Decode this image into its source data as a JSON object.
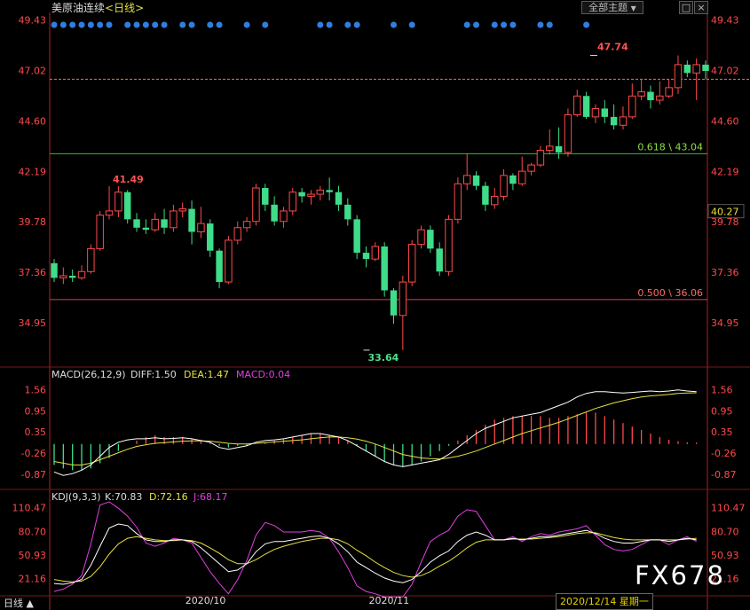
{
  "header": {
    "instrument": "美原油连续",
    "period": "<日线>",
    "dropdown_label": "全部主题",
    "dropdown_arrow": "▼"
  },
  "window_controls": {
    "square": "□",
    "close": "×"
  },
  "watermark": "FX678",
  "date_badge": "2020/12/14 星期一",
  "bottom_left": "日线 ▲",
  "colors": {
    "up": "#ff4a4a",
    "down": "#3fdc8a",
    "axis": "#b02020",
    "diff_line": "#ffffff",
    "dea_line": "#e8e040",
    "j_line": "#e040e0",
    "fib_618": "#30c030",
    "fib_500": "#d04060"
  },
  "chart_data": {
    "type": "candlestick",
    "price_axis": {
      "ticks": [
        49.43,
        47.02,
        44.6,
        42.19,
        39.78,
        37.36,
        34.95
      ],
      "tick_labels": [
        "49.43",
        "47.02",
        "44.60",
        "42.19",
        "39.78",
        "37.36",
        "34.95"
      ],
      "ylim": [
        33.0,
        49.8
      ]
    },
    "x_labels": [
      {
        "label": "2020/10",
        "index": 16.5
      },
      {
        "label": "2020/11",
        "index": 36.5
      }
    ],
    "annotations": {
      "high": {
        "label": "47.74",
        "value": 47.74,
        "index": 59
      },
      "prior_high": {
        "label": "41.49",
        "value": 41.49,
        "index": 6
      },
      "low": {
        "label": "33.64",
        "value": 33.64,
        "index": 34
      },
      "last_price": {
        "label": "40.27",
        "value": 40.27
      },
      "dashed_level": 46.6
    },
    "fib_levels": [
      {
        "label": "0.618 \\ 43.04",
        "value": 43.04
      },
      {
        "label": "0.500 \\ 36.06",
        "value": 36.06
      }
    ],
    "event_dots": [
      0,
      1,
      2,
      3,
      4,
      5,
      6,
      8,
      9,
      10,
      11,
      12,
      14,
      15,
      17,
      18,
      21,
      23,
      29,
      30,
      32,
      33,
      37,
      39,
      45,
      46,
      48,
      49,
      50,
      53,
      54,
      58
    ],
    "candles": [
      [
        37.8,
        37.1,
        38.0,
        36.9
      ],
      [
        37.1,
        37.2,
        37.6,
        36.8
      ],
      [
        37.2,
        37.1,
        37.5,
        36.9
      ],
      [
        37.1,
        37.4,
        37.7,
        37.0
      ],
      [
        37.4,
        38.5,
        38.7,
        37.3
      ],
      [
        38.5,
        40.1,
        40.3,
        38.4
      ],
      [
        40.1,
        40.3,
        41.49,
        39.9
      ],
      [
        40.3,
        41.2,
        41.49,
        40.0
      ],
      [
        41.2,
        39.9,
        41.3,
        39.7
      ],
      [
        39.9,
        39.5,
        40.2,
        39.3
      ],
      [
        39.5,
        39.4,
        39.9,
        39.2
      ],
      [
        39.4,
        39.9,
        40.2,
        39.3
      ],
      [
        39.9,
        39.5,
        40.4,
        39.2
      ],
      [
        39.5,
        40.3,
        40.6,
        39.3
      ],
      [
        40.3,
        40.4,
        40.7,
        40.0
      ],
      [
        40.4,
        39.3,
        40.8,
        38.7
      ],
      [
        39.3,
        39.7,
        40.5,
        39.0
      ],
      [
        39.7,
        38.4,
        39.9,
        38.1
      ],
      [
        38.4,
        36.9,
        38.5,
        36.6
      ],
      [
        36.9,
        38.9,
        39.1,
        36.8
      ],
      [
        38.9,
        39.5,
        39.8,
        38.7
      ],
      [
        39.5,
        39.8,
        40.0,
        39.3
      ],
      [
        39.8,
        41.4,
        41.6,
        39.6
      ],
      [
        41.4,
        40.6,
        41.6,
        40.3
      ],
      [
        40.6,
        39.8,
        41.0,
        39.6
      ],
      [
        39.8,
        40.3,
        40.5,
        39.5
      ],
      [
        40.3,
        41.2,
        41.4,
        40.1
      ],
      [
        41.2,
        41.0,
        41.4,
        40.7
      ],
      [
        41.0,
        41.1,
        41.3,
        40.6
      ],
      [
        41.1,
        41.3,
        41.5,
        40.8
      ],
      [
        41.3,
        41.2,
        41.9,
        40.8
      ],
      [
        41.2,
        40.6,
        41.5,
        40.3
      ],
      [
        40.6,
        39.9,
        40.9,
        39.6
      ],
      [
        39.9,
        38.3,
        40.1,
        38.0
      ],
      [
        38.3,
        38.0,
        38.6,
        37.6
      ],
      [
        38.0,
        38.6,
        38.8,
        37.9
      ],
      [
        38.6,
        36.5,
        38.8,
        36.2
      ],
      [
        36.5,
        35.3,
        36.6,
        34.9
      ],
      [
        35.3,
        36.9,
        37.2,
        33.64
      ],
      [
        36.9,
        38.7,
        38.9,
        36.7
      ],
      [
        38.7,
        39.4,
        39.6,
        38.5
      ],
      [
        39.4,
        38.5,
        39.6,
        38.3
      ],
      [
        38.5,
        37.4,
        38.8,
        37.2
      ],
      [
        37.4,
        39.9,
        40.1,
        37.2
      ],
      [
        39.9,
        41.6,
        41.9,
        39.7
      ],
      [
        41.6,
        42.0,
        43.04,
        41.3
      ],
      [
        42.0,
        41.5,
        42.2,
        41.3
      ],
      [
        41.5,
        40.6,
        41.7,
        40.3
      ],
      [
        40.6,
        41.0,
        41.4,
        40.4
      ],
      [
        41.0,
        42.0,
        42.3,
        40.8
      ],
      [
        42.0,
        41.6,
        42.1,
        41.3
      ],
      [
        41.6,
        42.2,
        42.9,
        41.5
      ],
      [
        42.2,
        42.5,
        42.6,
        42.0
      ],
      [
        42.5,
        43.2,
        43.4,
        42.4
      ],
      [
        43.2,
        43.4,
        44.2,
        43.0
      ],
      [
        43.4,
        43.1,
        44.3,
        42.8
      ],
      [
        43.1,
        44.9,
        45.2,
        42.9
      ],
      [
        44.9,
        45.8,
        46.1,
        44.8
      ],
      [
        45.8,
        44.8,
        46.0,
        44.7
      ],
      [
        44.8,
        45.2,
        45.4,
        44.5
      ],
      [
        45.2,
        44.8,
        45.6,
        44.5
      ],
      [
        44.8,
        44.4,
        45.4,
        44.2
      ],
      [
        44.4,
        44.8,
        45.3,
        44.2
      ],
      [
        44.8,
        45.8,
        46.4,
        44.7
      ],
      [
        45.8,
        46.0,
        46.6,
        45.6
      ],
      [
        46.0,
        45.6,
        46.3,
        45.2
      ],
      [
        45.6,
        45.8,
        46.5,
        45.4
      ],
      [
        45.8,
        46.2,
        46.6,
        45.7
      ],
      [
        46.2,
        47.3,
        47.74,
        45.9
      ],
      [
        47.3,
        46.9,
        47.5,
        46.7
      ],
      [
        46.9,
        47.3,
        47.6,
        45.6
      ],
      [
        47.3,
        47.0,
        47.5,
        46.6
      ]
    ],
    "macd": {
      "label": "MACD(26,12,9)",
      "diff_label": "DIFF:1.50",
      "dea_label": "DEA:1.47",
      "macd_label": "MACD:0.04",
      "ticks": [
        1.56,
        0.95,
        0.35,
        -0.26,
        -0.87
      ],
      "tick_labels": [
        "1.56",
        "0.95",
        "0.35",
        "-0.26",
        "-0.87"
      ],
      "ylim": [
        -1.2,
        1.85
      ],
      "hist": [
        -0.6,
        -0.7,
        -0.75,
        -0.75,
        -0.7,
        -0.55,
        -0.4,
        -0.2,
        0.0,
        0.1,
        0.2,
        0.25,
        0.2,
        0.2,
        0.2,
        0.15,
        0.1,
        0.05,
        -0.05,
        -0.1,
        -0.05,
        -0.05,
        0.0,
        0.05,
        0.1,
        0.15,
        0.2,
        0.25,
        0.3,
        0.3,
        0.25,
        0.2,
        0.1,
        -0.05,
        -0.2,
        -0.35,
        -0.5,
        -0.6,
        -0.65,
        -0.6,
        -0.5,
        -0.35,
        -0.2,
        -0.05,
        0.1,
        0.25,
        0.4,
        0.55,
        0.7,
        0.75,
        0.8,
        0.8,
        0.8,
        0.8,
        0.75,
        0.75,
        0.8,
        0.85,
        0.9,
        0.9,
        0.8,
        0.7,
        0.6,
        0.5,
        0.4,
        0.3,
        0.2,
        0.12,
        0.08,
        0.05,
        0.04
      ],
      "diff": [
        -0.8,
        -0.9,
        -0.85,
        -0.75,
        -0.6,
        -0.35,
        -0.1,
        0.05,
        0.12,
        0.15,
        0.15,
        0.18,
        0.15,
        0.16,
        0.18,
        0.15,
        0.1,
        0.05,
        -0.1,
        -0.15,
        -0.1,
        -0.05,
        0.05,
        0.1,
        0.12,
        0.15,
        0.2,
        0.25,
        0.3,
        0.3,
        0.25,
        0.2,
        0.1,
        -0.05,
        -0.2,
        -0.35,
        -0.5,
        -0.6,
        -0.65,
        -0.6,
        -0.55,
        -0.5,
        -0.45,
        -0.3,
        -0.1,
        0.1,
        0.3,
        0.45,
        0.55,
        0.65,
        0.75,
        0.8,
        0.85,
        0.9,
        1.0,
        1.1,
        1.2,
        1.35,
        1.45,
        1.5,
        1.5,
        1.48,
        1.46,
        1.48,
        1.5,
        1.52,
        1.5,
        1.52,
        1.55,
        1.52,
        1.5
      ],
      "dea": [
        -0.5,
        -0.55,
        -0.6,
        -0.6,
        -0.55,
        -0.45,
        -0.35,
        -0.25,
        -0.15,
        -0.07,
        -0.02,
        0.02,
        0.04,
        0.06,
        0.08,
        0.09,
        0.09,
        0.08,
        0.05,
        0.02,
        0.0,
        0.0,
        0.02,
        0.04,
        0.06,
        0.08,
        0.1,
        0.12,
        0.15,
        0.18,
        0.2,
        0.2,
        0.18,
        0.14,
        0.08,
        0.0,
        -0.1,
        -0.2,
        -0.3,
        -0.35,
        -0.4,
        -0.42,
        -0.43,
        -0.4,
        -0.35,
        -0.28,
        -0.2,
        -0.1,
        0.0,
        0.1,
        0.2,
        0.3,
        0.38,
        0.46,
        0.54,
        0.62,
        0.72,
        0.82,
        0.92,
        1.02,
        1.1,
        1.18,
        1.24,
        1.3,
        1.35,
        1.38,
        1.4,
        1.42,
        1.45,
        1.46,
        1.47
      ]
    },
    "kdj": {
      "label": "KDJ(9,3,3)",
      "k_label": "K:70.83",
      "d_label": "D:72.16",
      "j_label": "J:68.17",
      "ticks": [
        110.47,
        80.7,
        50.93,
        21.16
      ],
      "tick_labels": [
        "110.47",
        "80.70",
        "50.93",
        "21.16"
      ],
      "ylim": [
        -5,
        118
      ],
      "k": [
        15,
        14,
        16,
        20,
        38,
        62,
        85,
        90,
        88,
        78,
        70,
        68,
        68,
        70,
        70,
        68,
        60,
        50,
        40,
        30,
        32,
        40,
        55,
        65,
        68,
        68,
        70,
        72,
        74,
        75,
        72,
        65,
        55,
        42,
        35,
        28,
        22,
        18,
        16,
        20,
        30,
        42,
        50,
        56,
        68,
        76,
        80,
        76,
        70,
        70,
        72,
        70,
        72,
        74,
        74,
        76,
        78,
        80,
        82,
        78,
        72,
        68,
        66,
        66,
        68,
        70,
        70,
        68,
        70,
        72,
        70
      ],
      "d": [
        20,
        18,
        17,
        18,
        24,
        36,
        52,
        65,
        72,
        74,
        72,
        70,
        69,
        69,
        70,
        69,
        66,
        60,
        53,
        45,
        40,
        40,
        45,
        52,
        58,
        62,
        65,
        68,
        70,
        72,
        72,
        70,
        65,
        57,
        50,
        42,
        35,
        29,
        25,
        23,
        25,
        30,
        37,
        43,
        51,
        60,
        67,
        70,
        70,
        70,
        71,
        71,
        71,
        72,
        73,
        74,
        76,
        78,
        79,
        79,
        76,
        73,
        71,
        70,
        70,
        70,
        70,
        70,
        70,
        71,
        72
      ],
      "j": [
        5,
        8,
        14,
        25,
        65,
        114,
        118,
        110,
        100,
        86,
        66,
        62,
        66,
        72,
        70,
        66,
        48,
        30,
        15,
        2,
        20,
        44,
        76,
        92,
        88,
        80,
        80,
        80,
        82,
        80,
        72,
        55,
        35,
        12,
        5,
        2,
        -2,
        -2,
        -2,
        14,
        42,
        68,
        76,
        82,
        100,
        108,
        106,
        88,
        70,
        70,
        74,
        68,
        74,
        78,
        76,
        80,
        82,
        84,
        88,
        76,
        64,
        58,
        56,
        58,
        64,
        70,
        70,
        64,
        70,
        74,
        68
      ]
    }
  }
}
